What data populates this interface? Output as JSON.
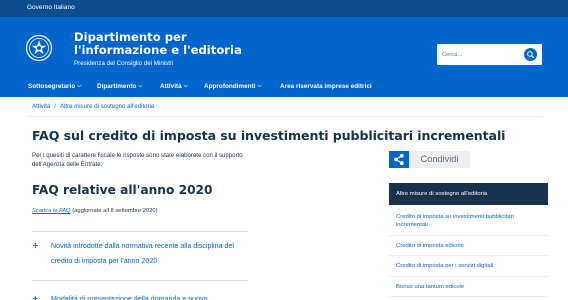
{
  "gov_bar": {
    "label": "Governo Italiano"
  },
  "header": {
    "title": "Dipartimento per l'informazione e l'editoria",
    "subtitle": "Presidenza del Consiglio dei Ministri",
    "search_placeholder": "Cerca...",
    "emblem_icon": "italian-republic-emblem",
    "search_icon": "search-icon"
  },
  "nav": {
    "items": [
      {
        "label": "Sottosegretario",
        "has_dropdown": true
      },
      {
        "label": "Dipartimento",
        "has_dropdown": true
      },
      {
        "label": "Attività",
        "has_dropdown": true
      },
      {
        "label": "Approfondimenti",
        "has_dropdown": true
      },
      {
        "label": "Area riservata imprese editrici",
        "has_dropdown": false
      }
    ]
  },
  "breadcrumb": {
    "items": [
      "Attività",
      "Altre misure di sostegno all'editoria"
    ],
    "separator": "/"
  },
  "main": {
    "title": "FAQ sul credito di imposta su investimenti pubblicitari incrementali",
    "intro": "Per i quesiti di carattere fiscale le risposte sono state elaborate con il supporto dell'Agenzia delle Entrate.",
    "share_label": "Condividi",
    "section_title": "FAQ relative all'anno 2020",
    "download_link": "Scarica le FAQ",
    "download_note": "(aggiornate all 8 settembre 2020)",
    "accordion": [
      {
        "toggle": "+",
        "text": "Novità introdotte dalla normativa recente alla disciplina del credito di imposta per l'anno 2020"
      },
      {
        "toggle": "+",
        "text": "Modalità di presentazione della domanda e nuovo"
      }
    ]
  },
  "sidebar": {
    "heading": "Altre misure di sostegno all'editoria",
    "items": [
      "Credito di imposta su investimenti pubblicitari incrementali",
      "Credito di imposta edicole",
      "Credito di imposta per i servizi digitali",
      "Bonus una tantum edicole"
    ]
  },
  "colors": {
    "gov_bar": "#0d4d8f",
    "header": "#0066cc",
    "heading_text": "#17324d",
    "link": "#0066cc",
    "share_bg": "#eeeeee"
  }
}
